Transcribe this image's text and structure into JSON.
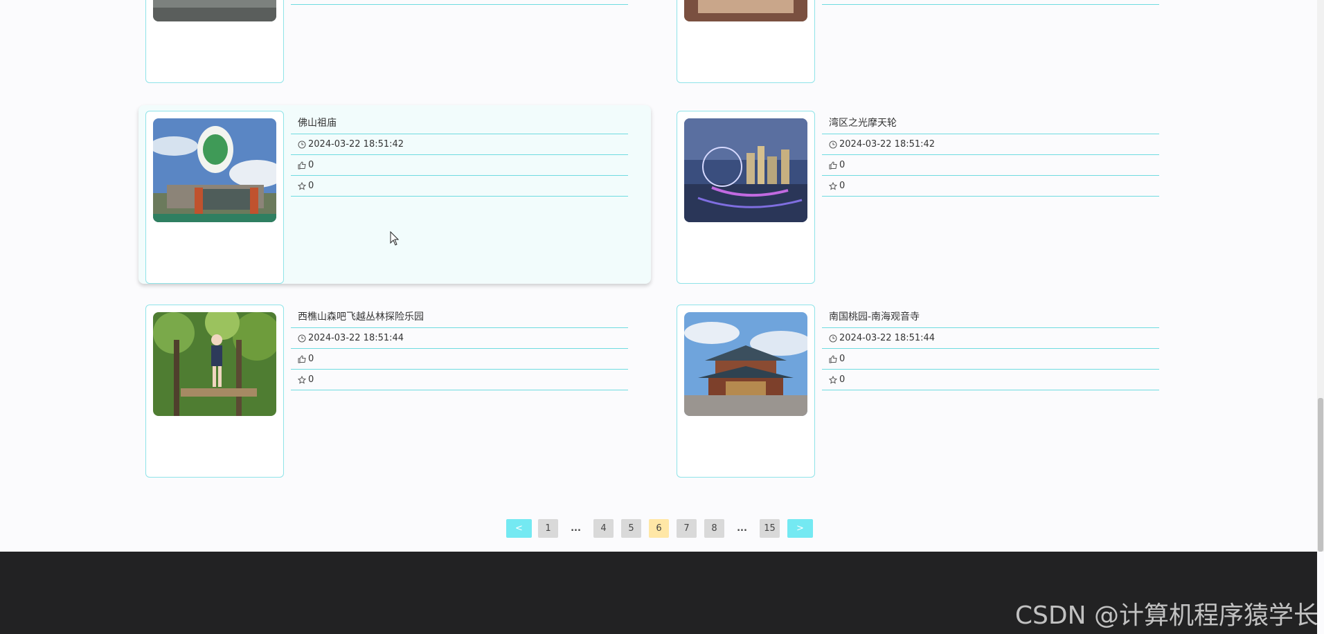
{
  "cards": [
    {
      "title": "",
      "date": "",
      "likes": "",
      "favs": ""
    },
    {
      "title": "",
      "date": "",
      "likes": "",
      "favs": ""
    },
    {
      "title": "佛山祖庙",
      "date": "2024-03-22 18:51:42",
      "likes": "0",
      "favs": "0"
    },
    {
      "title": "湾区之光摩天轮",
      "date": "2024-03-22 18:51:42",
      "likes": "0",
      "favs": "0"
    },
    {
      "title": "西樵山森吧飞越丛林探险乐园",
      "date": "2024-03-22 18:51:44",
      "likes": "0",
      "favs": "0"
    },
    {
      "title": "南国桃园-南海观音寺",
      "date": "2024-03-22 18:51:44",
      "likes": "0",
      "favs": "0"
    }
  ],
  "pagination": {
    "prev": "<",
    "next": ">",
    "pages": [
      "1",
      "...",
      "4",
      "5",
      "6",
      "7",
      "8",
      "...",
      "15"
    ],
    "current": "6"
  },
  "watermark": "CSDN @计算机程序猿学长",
  "colors": {
    "accent": "#74e9f2",
    "border": "#8ee3e8",
    "active_page": "#ffe7a6",
    "footer": "#222223"
  }
}
